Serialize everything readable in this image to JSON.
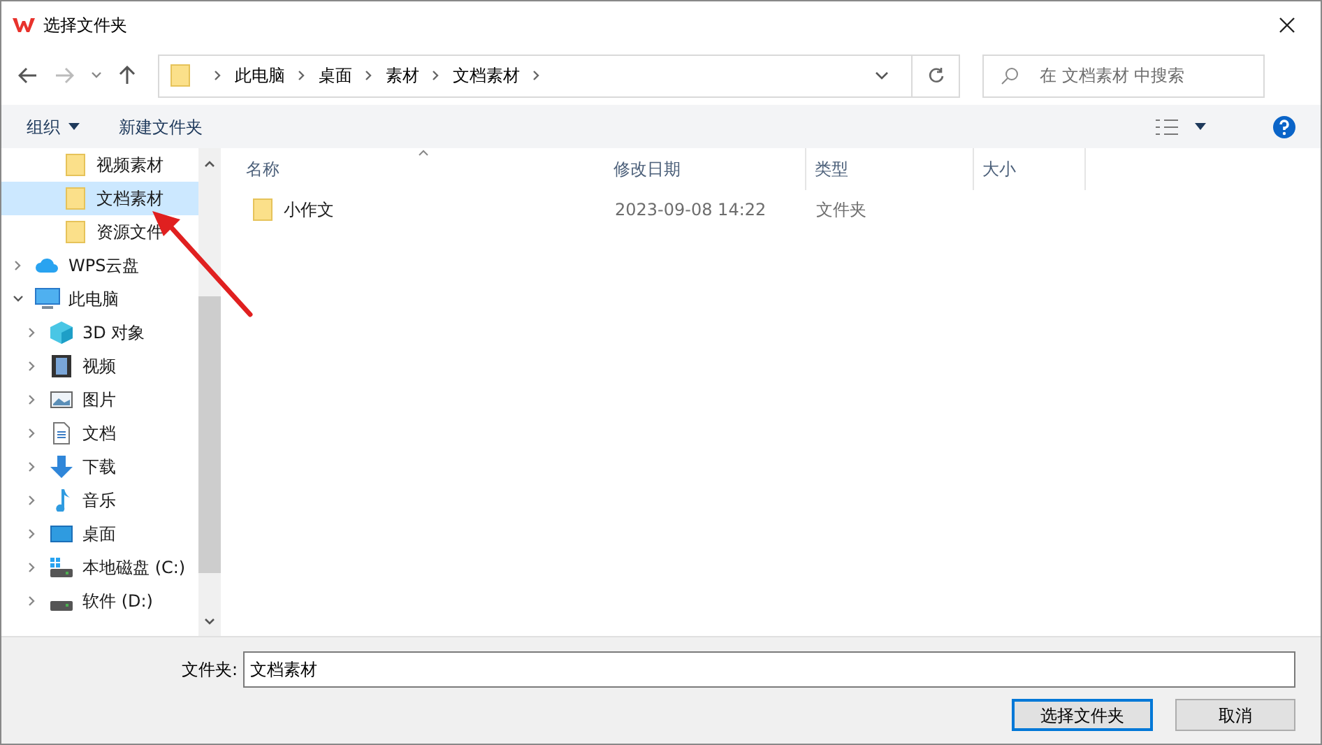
{
  "window": {
    "title": "选择文件夹"
  },
  "address": {
    "crumbs": [
      "此电脑",
      "桌面",
      "素材",
      "文档素材"
    ]
  },
  "search": {
    "placeholder": "在 文档素材 中搜索"
  },
  "toolbar": {
    "organize": "组织",
    "new_folder": "新建文件夹"
  },
  "nav": {
    "continued_items": [
      {
        "label": "视频素材",
        "kind": "folder",
        "selected": false
      },
      {
        "label": "文档素材",
        "kind": "folder",
        "selected": true
      },
      {
        "label": "资源文件",
        "kind": "folder",
        "selected": false
      }
    ],
    "tree": [
      {
        "label": "WPS云盘",
        "kind": "cloud",
        "selected": false,
        "expanded": false
      },
      {
        "label": "此电脑",
        "kind": "pc",
        "selected": false,
        "expanded": true,
        "children": [
          {
            "label": "3D 对象",
            "kind": "cube",
            "selected": false,
            "expanded": false
          },
          {
            "label": "视频",
            "kind": "video",
            "selected": false,
            "expanded": false
          },
          {
            "label": "图片",
            "kind": "picture",
            "selected": false,
            "expanded": false
          },
          {
            "label": "文档",
            "kind": "document",
            "selected": false,
            "expanded": false
          },
          {
            "label": "下载",
            "kind": "download",
            "selected": false,
            "expanded": false
          },
          {
            "label": "音乐",
            "kind": "music",
            "selected": false,
            "expanded": false
          },
          {
            "label": "桌面",
            "kind": "desktop",
            "selected": false,
            "expanded": false
          },
          {
            "label": "本地磁盘 (C:)",
            "kind": "system-drive",
            "selected": false,
            "expanded": false
          },
          {
            "label": "软件 (D:)",
            "kind": "drive",
            "selected": false,
            "expanded": false
          }
        ]
      }
    ]
  },
  "table": {
    "columns": [
      "名称",
      "修改日期",
      "类型",
      "大小"
    ],
    "rows": [
      {
        "name": "小作文",
        "modified": "2023-09-08 14:22",
        "type": "文件夹"
      }
    ]
  },
  "footer": {
    "folder_label": "文件夹:",
    "folder_value": "文档素材",
    "buttons": [
      "选择文件夹",
      "取消"
    ]
  }
}
